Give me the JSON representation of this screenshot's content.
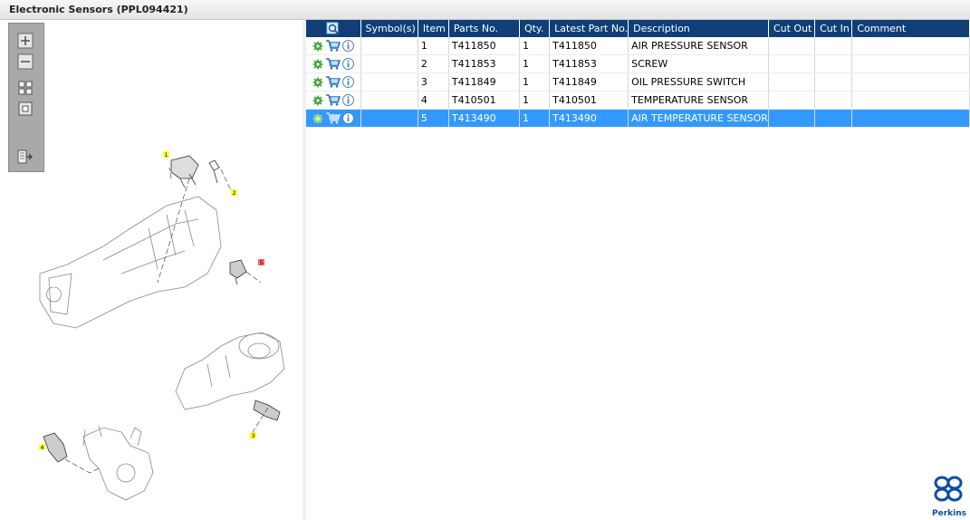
{
  "window": {
    "title": "Electronic Sensors (PPL094421)"
  },
  "toolbar": {
    "buttons": [
      {
        "name": "zoom-in-button",
        "icon": "zoom-in-icon"
      },
      {
        "name": "zoom-out-button",
        "icon": "zoom-out-icon"
      },
      {
        "name": "fit-all-button",
        "icon": "fit-all-icon"
      },
      {
        "name": "actual-size-button",
        "icon": "actual-size-icon"
      },
      {
        "name": "export-button",
        "icon": "export-icon"
      }
    ]
  },
  "illustration": {
    "callouts": [
      "1",
      "2",
      "3",
      "4",
      "5"
    ],
    "highlight_color": "#ffff33",
    "selected_color": "#ff6666"
  },
  "table": {
    "headers": [
      "",
      "Symbol(s)",
      "Item",
      "Parts No.",
      "Qty.",
      "Latest Part No.",
      "Description",
      "Cut Out",
      "Cut In",
      "Comment"
    ],
    "rows": [
      {
        "item": "1",
        "parts_no": "T411850",
        "qty": "1",
        "latest": "T411850",
        "desc": "AIR PRESSURE SENSOR",
        "selected": false
      },
      {
        "item": "2",
        "parts_no": "T411853",
        "qty": "1",
        "latest": "T411853",
        "desc": "SCREW",
        "selected": false
      },
      {
        "item": "3",
        "parts_no": "T411849",
        "qty": "1",
        "latest": "T411849",
        "desc": "OIL PRESSURE SWITCH",
        "selected": false
      },
      {
        "item": "4",
        "parts_no": "T410501",
        "qty": "1",
        "latest": "T410501",
        "desc": "TEMPERATURE SENSOR",
        "selected": false
      },
      {
        "item": "5",
        "parts_no": "T413490",
        "qty": "1",
        "latest": "T413490",
        "desc": "AIR TEMPERATURE SENSOR",
        "selected": true
      }
    ]
  },
  "brand": {
    "name": "Perkins",
    "color": "#0d4ea0"
  },
  "colors": {
    "header_bg": "#0f3f76",
    "selected_row": "#3399ff"
  }
}
